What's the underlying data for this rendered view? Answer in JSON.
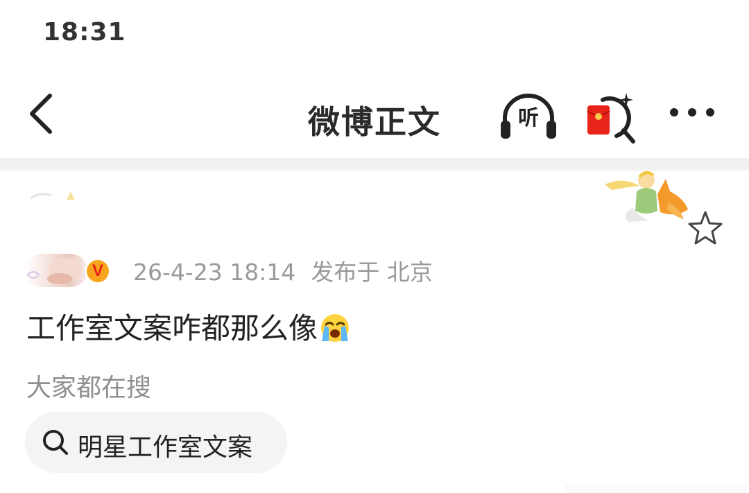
{
  "status_bar": {
    "time": "18:31"
  },
  "nav": {
    "title": "微博正文",
    "listen_label": "听"
  },
  "post": {
    "timestamp": "26-4-23 18:14",
    "location": "发布于 北京",
    "text": "工作室文案咋都那么像",
    "emoji": "crying-face-icon",
    "verified_mark": "V"
  },
  "related_search": {
    "title": "大家都在搜",
    "suggestion": "明星工作室文案"
  },
  "colors": {
    "badge_bg": "#f7a51c",
    "badge_mark": "#e8231a",
    "hongbao_red": "#e8231a",
    "meta_gray": "#9a9a9a",
    "chip_bg": "#f4f4f4"
  }
}
